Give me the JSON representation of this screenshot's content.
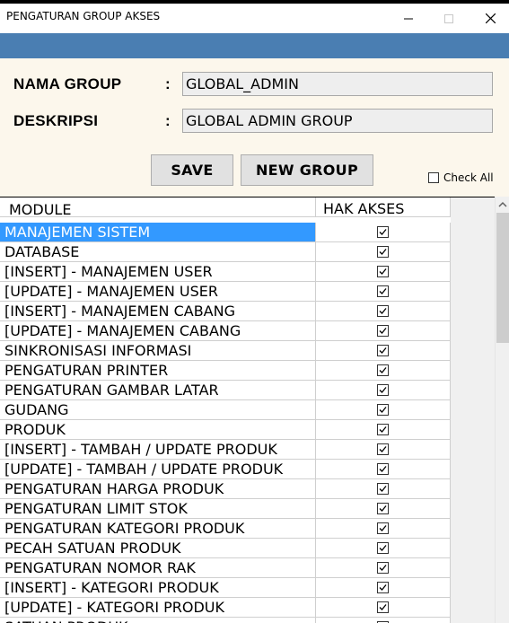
{
  "window": {
    "title": "PENGATURAN GROUP AKSES"
  },
  "form": {
    "nama_group_label": "NAMA GROUP",
    "deskripsi_label": "DESKRIPSI",
    "colon": ":",
    "nama_group_value": "GLOBAL_ADMIN",
    "deskripsi_value": "GLOBAL ADMIN GROUP",
    "save_label": "SAVE",
    "new_group_label": "NEW GROUP",
    "check_all_label": "Check All",
    "check_all_checked": false
  },
  "grid": {
    "columns": [
      "MODULE",
      "HAK AKSES"
    ],
    "rows": [
      {
        "module": "MANAJEMEN SISTEM",
        "checked": true,
        "selected": true
      },
      {
        "module": "DATABASE",
        "checked": true
      },
      {
        "module": "[INSERT] - MANAJEMEN USER",
        "checked": true
      },
      {
        "module": "[UPDATE] - MANAJEMEN USER",
        "checked": true
      },
      {
        "module": "[INSERT] - MANAJEMEN CABANG",
        "checked": true
      },
      {
        "module": "[UPDATE] - MANAJEMEN CABANG",
        "checked": true
      },
      {
        "module": "SINKRONISASI INFORMASI",
        "checked": true
      },
      {
        "module": "PENGATURAN PRINTER",
        "checked": true
      },
      {
        "module": "PENGATURAN GAMBAR LATAR",
        "checked": true
      },
      {
        "module": "GUDANG",
        "checked": true
      },
      {
        "module": "PRODUK",
        "checked": true
      },
      {
        "module": "[INSERT] - TAMBAH / UPDATE PRODUK",
        "checked": true
      },
      {
        "module": "[UPDATE] - TAMBAH / UPDATE PRODUK",
        "checked": true
      },
      {
        "module": "PENGATURAN HARGA PRODUK",
        "checked": true
      },
      {
        "module": "PENGATURAN LIMIT STOK",
        "checked": true
      },
      {
        "module": "PENGATURAN KATEGORI PRODUK",
        "checked": true
      },
      {
        "module": "PECAH SATUAN PRODUK",
        "checked": true
      },
      {
        "module": "PENGATURAN NOMOR RAK",
        "checked": true
      },
      {
        "module": "[INSERT] - KATEGORI PRODUK",
        "checked": true
      },
      {
        "module": "[UPDATE] - KATEGORI PRODUK",
        "checked": true
      },
      {
        "module": "SATUAN PRODUK",
        "checked": true
      }
    ]
  },
  "colors": {
    "header_bar": "#4a7eb2",
    "form_background": "#fcf7ec",
    "selection": "#3399ff"
  }
}
